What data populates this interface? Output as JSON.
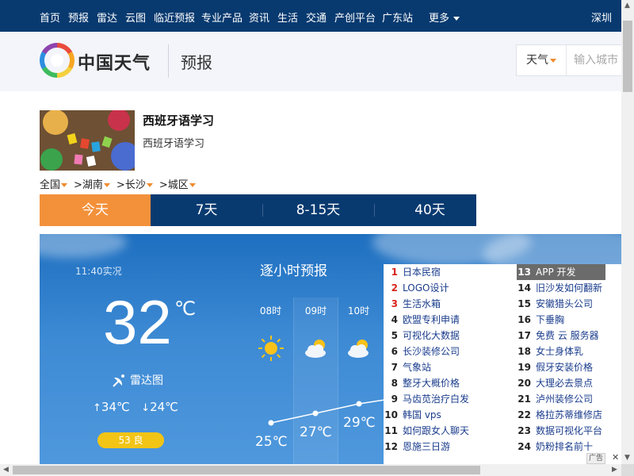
{
  "topnav": {
    "items": [
      "首页",
      "预报",
      "雷达",
      "云图",
      "临近预报",
      "专业产品",
      "资讯",
      "生活",
      "交通",
      "产创平台",
      "广东站"
    ],
    "more_label": "更多",
    "city": "深圳"
  },
  "header": {
    "logo_text": "中国天气",
    "section_title": "预报",
    "search_type": "天气",
    "search_placeholder": "输入城市"
  },
  "ad_card": {
    "title": "西班牙语学习",
    "description": "西班牙语学习"
  },
  "breadcrumb": [
    {
      "label": "全国"
    },
    {
      "label": ">湖南"
    },
    {
      "label": ">长沙"
    },
    {
      "label": ">城区"
    }
  ],
  "tabs": [
    "今天",
    "7天",
    "8-15天",
    "40天"
  ],
  "weather": {
    "observed_time": "11:40实况",
    "temperature": "32",
    "unit": "℃",
    "radar_label": "雷达图",
    "high": "34℃",
    "low": "24℃",
    "aqi_label": "53 良",
    "hourly_title": "逐小时预报",
    "hours": [
      {
        "time": "08时",
        "icon": "sun-icon",
        "temp": "25℃",
        "temp_value": 25
      },
      {
        "time": "09时",
        "icon": "partly-cloudy-icon",
        "temp": "27℃",
        "temp_value": 27
      },
      {
        "time": "10时",
        "icon": "partly-cloudy-icon",
        "temp": "29℃",
        "temp_value": 29
      }
    ]
  },
  "ranklist": [
    {
      "num": "1",
      "text": "日本民宿",
      "hot": true
    },
    {
      "num": "2",
      "text": "LOGO设计",
      "hot": true
    },
    {
      "num": "3",
      "text": "生活水箱",
      "hot": true
    },
    {
      "num": "4",
      "text": "欧盟专利申请"
    },
    {
      "num": "5",
      "text": "可视化大数据"
    },
    {
      "num": "6",
      "text": "长沙装修公司"
    },
    {
      "num": "7",
      "text": "气象站"
    },
    {
      "num": "8",
      "text": "整牙大概价格"
    },
    {
      "num": "9",
      "text": "马齿苋治疗白发"
    },
    {
      "num": "10",
      "text": "韩国 vps"
    },
    {
      "num": "11",
      "text": "如何跟女人聊天"
    },
    {
      "num": "12",
      "text": "恩施三日游"
    },
    {
      "num": "13",
      "text": "APP 开发",
      "highlight": true
    },
    {
      "num": "14",
      "text": "旧沙发如何翻新"
    },
    {
      "num": "15",
      "text": "安徽猎头公司"
    },
    {
      "num": "16",
      "text": "下垂胸"
    },
    {
      "num": "17",
      "text": "免费 云 服务器"
    },
    {
      "num": "18",
      "text": "女士身体乳"
    },
    {
      "num": "19",
      "text": "假牙安装价格"
    },
    {
      "num": "20",
      "text": "大理必去景点"
    },
    {
      "num": "21",
      "text": "泸州装修公司"
    },
    {
      "num": "22",
      "text": "格拉苏蒂维修店"
    },
    {
      "num": "23",
      "text": "数据可视化平台"
    },
    {
      "num": "24",
      "text": "奶粉排名前十"
    }
  ],
  "ad_badge": "广告",
  "ad_close": "✕",
  "colors": {
    "nav_bg": "#083a70",
    "tab_active": "#f3913a",
    "aqi_good": "#f2c415",
    "rank_hot": "#d9251c"
  }
}
